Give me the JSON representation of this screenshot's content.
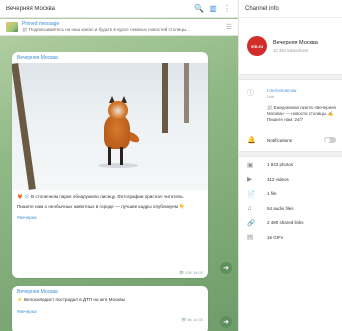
{
  "chat": {
    "title": "Вечерняя Москва",
    "pinned": {
      "label": "Pinned message",
      "text": "📰 Подписывайтесь на наш канал и будьте в курсе главных новостей столицы..."
    },
    "messages": [
      {
        "sender": "Вечерняя Москва",
        "paragraphs": [
          "🦊 ❄️ В столичном парке обнаружили лисицу. Фотографии прислал читатель.",
          "Пишите нам о необычных животных в городе — лучшие кадры опубликуем 👇"
        ],
        "link": "#вечерка",
        "meta": "👁 12К 14:02"
      },
      {
        "sender": "Вечерняя Москва",
        "paragraphs": [
          "⚡️ Велосипедист пострадал в ДТП на юге Москвы"
        ],
        "link": "#вечерка",
        "meta": "👁 8К 14:30"
      }
    ]
  },
  "info": {
    "title": "Channel info",
    "avatar_text": "vm.ru",
    "name": "Вечерняя Москва",
    "subscribers": "12 345 subscribers",
    "link": "t.me/vmoscow",
    "link_label": "Link",
    "description": "📰 Ежедневная газета «Вечерняя Москва» — новости столицы. ✍️ Пишите нам: 24/7",
    "notifications": "Notifications",
    "stats": [
      {
        "icon": "photo-icon",
        "glyph": "▣",
        "label": "1 843 photos"
      },
      {
        "icon": "video-icon",
        "glyph": "▶",
        "label": "312 videos"
      },
      {
        "icon": "file-icon",
        "glyph": "📄",
        "label": "1 file"
      },
      {
        "icon": "audio-icon",
        "glyph": "♫",
        "label": "54 audio files"
      },
      {
        "icon": "link-icon",
        "glyph": "🔗",
        "label": "2 480 shared links"
      },
      {
        "icon": "gif-icon",
        "glyph": "▤",
        "label": "16 GIFs"
      }
    ]
  }
}
